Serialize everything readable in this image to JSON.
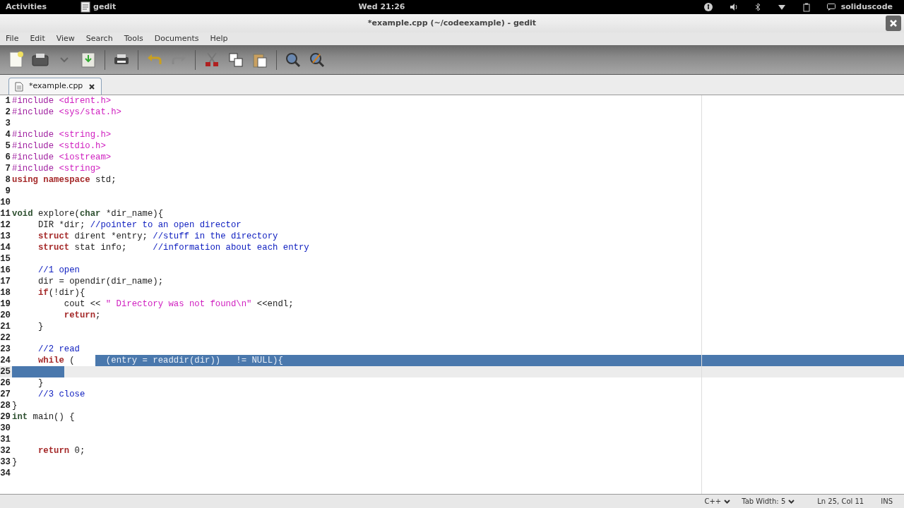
{
  "top_bar": {
    "activities": "Activities",
    "app_name": "gedit",
    "clock": "Wed 21:26",
    "user": "soliduscode"
  },
  "window": {
    "title": "*example.cpp (~/codeexample) - gedit"
  },
  "menu": [
    "File",
    "Edit",
    "View",
    "Search",
    "Tools",
    "Documents",
    "Help"
  ],
  "tabs": [
    {
      "label": "*example.cpp",
      "selected": true
    }
  ],
  "editor": {
    "lines": [
      {
        "number": "1",
        "tokens": [
          {
            "kind": "preproc",
            "text": "#include "
          },
          {
            "kind": "string",
            "text": "<dirent.h>"
          }
        ]
      },
      {
        "number": "2",
        "tokens": [
          {
            "kind": "preproc",
            "text": "#include "
          },
          {
            "kind": "string",
            "text": "<sys/stat.h>"
          }
        ]
      },
      {
        "number": "3"
      },
      {
        "number": "4",
        "tokens": [
          {
            "kind": "preproc",
            "text": "#include "
          },
          {
            "kind": "string",
            "text": "<string.h>"
          }
        ]
      },
      {
        "number": "5",
        "tokens": [
          {
            "kind": "preproc",
            "text": "#include "
          },
          {
            "kind": "string",
            "text": "<stdio.h>"
          }
        ]
      },
      {
        "number": "6",
        "tokens": [
          {
            "kind": "preproc",
            "text": "#include "
          },
          {
            "kind": "string",
            "text": "<iostream>"
          }
        ]
      },
      {
        "number": "7",
        "tokens": [
          {
            "kind": "preproc",
            "text": "#include "
          },
          {
            "kind": "string",
            "text": "<string>"
          }
        ]
      },
      {
        "number": "8",
        "tokens": [
          {
            "kind": "keyword",
            "text": "using namespace"
          },
          {
            "kind": "plain",
            "text": " std;"
          }
        ]
      },
      {
        "number": "9"
      },
      {
        "number": "10"
      },
      {
        "number": "11",
        "tokens": [
          {
            "kind": "type",
            "text": "void"
          },
          {
            "kind": "plain",
            "text": " explore("
          },
          {
            "kind": "type",
            "text": "char"
          },
          {
            "kind": "plain",
            "text": " *dir_name){"
          }
        ]
      },
      {
        "number": "12",
        "tokens": [
          {
            "kind": "plain",
            "text": "     DIR *dir; "
          },
          {
            "kind": "comment",
            "text": "//pointer to an open director"
          }
        ]
      },
      {
        "number": "13",
        "tokens": [
          {
            "kind": "keyword",
            "text": "     struct"
          },
          {
            "kind": "plain",
            "text": " dirent *entry; "
          },
          {
            "kind": "comment",
            "text": "//stuff in the directory"
          }
        ]
      },
      {
        "number": "14",
        "tokens": [
          {
            "kind": "keyword",
            "text": "     struct"
          },
          {
            "kind": "plain",
            "text": " stat info;     "
          },
          {
            "kind": "comment",
            "text": "//information about each entry"
          }
        ]
      },
      {
        "number": "15"
      },
      {
        "number": "16",
        "tokens": [
          {
            "kind": "comment",
            "text": "     //1 open"
          }
        ]
      },
      {
        "number": "17",
        "tokens": [
          {
            "kind": "plain",
            "text": "     dir = opendir(dir_name);"
          }
        ]
      },
      {
        "number": "18",
        "tokens": [
          {
            "kind": "keyword",
            "text": "     if"
          },
          {
            "kind": "plain",
            "text": "(!dir){"
          }
        ]
      },
      {
        "number": "19",
        "tokens": [
          {
            "kind": "plain",
            "text": "          cout << "
          },
          {
            "kind": "string",
            "text": "\" Directory was not found\\n\""
          },
          {
            "kind": "plain",
            "text": " <<endl;"
          }
        ]
      },
      {
        "number": "20",
        "tokens": [
          {
            "kind": "keyword",
            "text": "          return"
          },
          {
            "kind": "plain",
            "text": ";"
          }
        ]
      },
      {
        "number": "21",
        "tokens": [
          {
            "kind": "plain",
            "text": "     }"
          }
        ]
      },
      {
        "number": "22"
      },
      {
        "number": "23",
        "tokens": [
          {
            "kind": "comment",
            "text": "     //2 read"
          }
        ]
      },
      {
        "number": "24",
        "tokens": [
          {
            "kind": "keyword",
            "text": "     while"
          },
          {
            "kind": "plain",
            "text": " (    "
          },
          {
            "kind": "selection",
            "text": "  (entry = readdir(dir))   != NULL){"
          }
        ],
        "selected_to_end": true
      },
      {
        "number": "25",
        "current": true,
        "selected_from_start": true
      },
      {
        "number": "26",
        "tokens": [
          {
            "kind": "plain",
            "text": "     }"
          }
        ]
      },
      {
        "number": "27",
        "tokens": [
          {
            "kind": "comment",
            "text": "     //3 close"
          }
        ]
      },
      {
        "number": "28",
        "tokens": [
          {
            "kind": "plain",
            "text": "}"
          }
        ]
      },
      {
        "number": "29",
        "tokens": [
          {
            "kind": "type",
            "text": "int"
          },
          {
            "kind": "plain",
            "text": " main() {"
          }
        ]
      },
      {
        "number": "30"
      },
      {
        "number": "31"
      },
      {
        "number": "32",
        "tokens": [
          {
            "kind": "keyword",
            "text": "     return"
          },
          {
            "kind": "plain",
            "text": " 0;"
          }
        ]
      },
      {
        "number": "33",
        "tokens": [
          {
            "kind": "plain",
            "text": "}"
          }
        ]
      },
      {
        "number": "34"
      }
    ]
  },
  "status_bar": {
    "language": "C++",
    "tab_width": "Tab Width: 5",
    "position": "Ln 25, Col 11",
    "mode": "INS"
  }
}
